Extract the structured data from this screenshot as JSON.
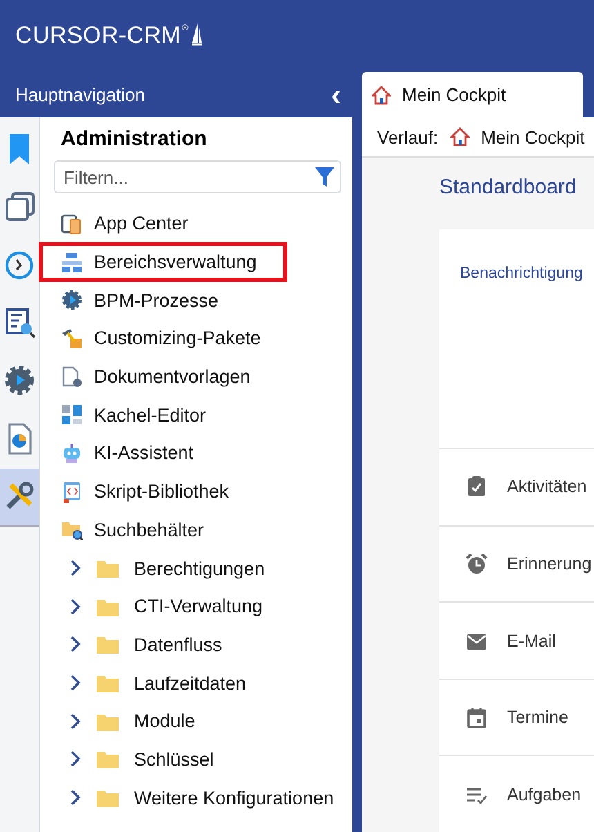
{
  "app": {
    "logo": "CURSOR-CRM",
    "logo_mark": "®"
  },
  "navigation": {
    "title": "Hauptnavigation",
    "collapse": "‹"
  },
  "rail": [
    {
      "kind": "bookmark",
      "selected": false
    },
    {
      "kind": "windows",
      "selected": false
    },
    {
      "kind": "history",
      "selected": false
    },
    {
      "kind": "search",
      "selected": false
    },
    {
      "kind": "gear",
      "selected": false
    },
    {
      "kind": "report",
      "selected": false
    },
    {
      "kind": "tools",
      "selected": true
    }
  ],
  "panel": {
    "title": "Administration",
    "filter": {
      "placeholder": "Filtern..."
    },
    "items": [
      {
        "label": "App Center",
        "kind": "app",
        "highlighted": false
      },
      {
        "label": "Bereichsverwaltung",
        "kind": "hierarchy",
        "highlighted": true
      },
      {
        "label": "BPM-Prozesse",
        "kind": "gear",
        "highlighted": false
      },
      {
        "label": "Customizing-Pakete",
        "kind": "package",
        "highlighted": false
      },
      {
        "label": "Dokumentvorlagen",
        "kind": "document",
        "highlighted": false
      },
      {
        "label": "Kachel-Editor",
        "kind": "tiles",
        "highlighted": false
      },
      {
        "label": "KI-Assistent",
        "kind": "robot",
        "highlighted": false
      },
      {
        "label": "Skript-Bibliothek",
        "kind": "book",
        "highlighted": false
      },
      {
        "label": "Suchbehälter",
        "kind": "search-folder",
        "highlighted": false
      },
      {
        "label": "Berechtigungen",
        "kind": "folder",
        "expanded": false,
        "highlighted": false
      },
      {
        "label": "CTI-Verwaltung",
        "kind": "folder",
        "expanded": false,
        "highlighted": false
      },
      {
        "label": "Datenfluss",
        "kind": "folder",
        "expanded": false,
        "highlighted": false
      },
      {
        "label": "Laufzeitdaten",
        "kind": "folder",
        "expanded": false,
        "highlighted": false
      },
      {
        "label": "Module",
        "kind": "folder",
        "expanded": false,
        "highlighted": false
      },
      {
        "label": "Schlüssel",
        "kind": "folder",
        "expanded": false,
        "highlighted": false
      },
      {
        "label": "Weitere Konfigurationen",
        "kind": "folder",
        "expanded": false,
        "highlighted": false
      }
    ]
  },
  "tabs": [
    {
      "label": "Mein Cockpit",
      "selected": true
    }
  ],
  "history": {
    "label": "Verlauf:",
    "entries": [
      "Mein Cockpit"
    ]
  },
  "board": {
    "title": "Standardboard",
    "card_title": "Benachrichtigung",
    "rows": [
      {
        "label": "Aktivitäten",
        "kind": "clipboard"
      },
      {
        "label": "Erinnerung",
        "kind": "alarm"
      },
      {
        "label": "E-Mail",
        "kind": "mail"
      },
      {
        "label": "Termine",
        "kind": "calendar"
      },
      {
        "label": "Aufgaben",
        "kind": "checklist"
      }
    ]
  }
}
